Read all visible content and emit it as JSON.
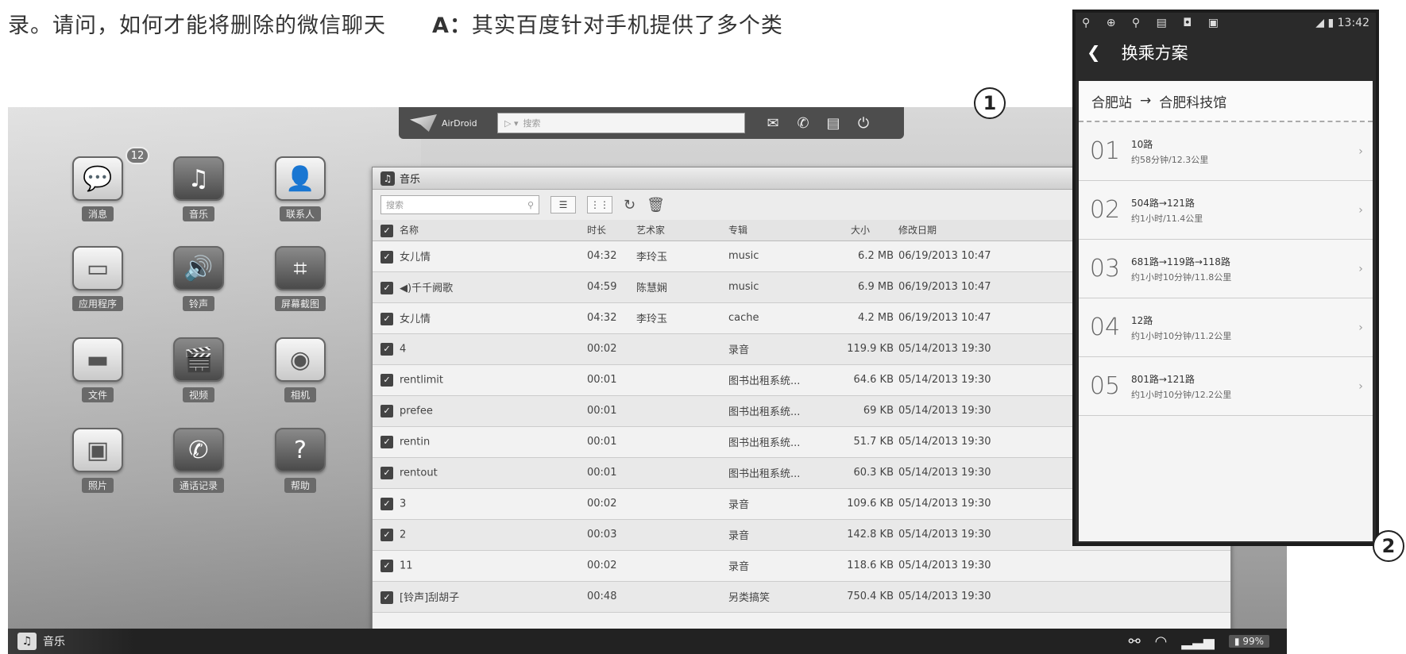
{
  "caption": {
    "left": "录。请问，如何才能将删除的微信聊天",
    "right_prefix": "A：",
    "right": "其实百度针对手机提供了多个类"
  },
  "markers": {
    "one": "1",
    "two": "2"
  },
  "airdroid": {
    "logo_text": "AirDroid",
    "search_placeholder": "搜索",
    "top_icons": [
      "mail-icon",
      "phone-icon",
      "sms-icon",
      "power-icon"
    ],
    "apps": [
      {
        "name": "messages-app",
        "label": "消息",
        "icon": "💬",
        "badge": "12",
        "light": true
      },
      {
        "name": "music-app",
        "label": "音乐",
        "icon": "♫",
        "light": false
      },
      {
        "name": "contacts-app",
        "label": "联系人",
        "icon": "👤",
        "light": true
      },
      {
        "name": "apps-app",
        "label": "应用程序",
        "icon": "▭",
        "light": true
      },
      {
        "name": "ringtones-app",
        "label": "铃声",
        "icon": "🔊",
        "light": false
      },
      {
        "name": "screenshot-app",
        "label": "屏幕截图",
        "icon": "⌗",
        "light": false
      },
      {
        "name": "files-app",
        "label": "文件",
        "icon": "▬",
        "light": true
      },
      {
        "name": "video-app",
        "label": "视频",
        "icon": "🎬",
        "light": false
      },
      {
        "name": "camera-app",
        "label": "相机",
        "icon": "◉",
        "light": true
      },
      {
        "name": "photos-app",
        "label": "照片",
        "icon": "▣",
        "light": true
      },
      {
        "name": "call-log-app",
        "label": "通话记录",
        "icon": "✆",
        "light": false
      },
      {
        "name": "help-app",
        "label": "帮助",
        "icon": "?",
        "light": false
      }
    ],
    "music_window": {
      "title": "音乐",
      "search_placeholder": "搜索",
      "columns": [
        "名称",
        "时长",
        "艺术家",
        "专辑",
        "大小",
        "修改日期"
      ],
      "rows": [
        [
          "女儿情",
          "04:32",
          "李玲玉",
          "music",
          "6.2 MB",
          "06/19/2013 10:47"
        ],
        [
          "◀)千千阙歌",
          "04:59",
          "陈慧娴",
          "music",
          "6.9 MB",
          "06/19/2013 10:47"
        ],
        [
          "女儿情",
          "04:32",
          "李玲玉",
          "cache",
          "4.2 MB",
          "06/19/2013 10:47"
        ],
        [
          "4",
          "00:02",
          "",
          "录音",
          "119.9 KB",
          "05/14/2013 19:30"
        ],
        [
          "rentlimit",
          "00:01",
          "",
          "图书出租系统...",
          "64.6 KB",
          "05/14/2013 19:30"
        ],
        [
          "prefee",
          "00:01",
          "",
          "图书出租系统...",
          "69 KB",
          "05/14/2013 19:30"
        ],
        [
          "rentin",
          "00:01",
          "",
          "图书出租系统...",
          "51.7 KB",
          "05/14/2013 19:30"
        ],
        [
          "rentout",
          "00:01",
          "",
          "图书出租系统...",
          "60.3 KB",
          "05/14/2013 19:30"
        ],
        [
          "3",
          "00:02",
          "",
          "录音",
          "109.6 KB",
          "05/14/2013 19:30"
        ],
        [
          "2",
          "00:03",
          "",
          "录音",
          "142.8 KB",
          "05/14/2013 19:30"
        ],
        [
          "11",
          "00:02",
          "",
          "录音",
          "118.6 KB",
          "05/14/2013 19:30"
        ],
        [
          "[铃声]刮胡子",
          "00:48",
          "",
          "另类搞笑",
          "750.4 KB",
          "05/14/2013 19:30"
        ]
      ]
    },
    "taskbar": {
      "item_label": "音乐",
      "battery": "99%"
    }
  },
  "phone": {
    "status_left": "⚲ ⊕ ⚲ ▤ ◘ ▣",
    "status_right": "13:42",
    "title": "换乘方案",
    "route_from": "合肥站",
    "route_arrow": "→",
    "route_to": "合肥科技馆",
    "plans": [
      {
        "num": "01",
        "lines": "10路",
        "detail": "约58分钟/12.3公里"
      },
      {
        "num": "02",
        "lines": "504路→121路",
        "detail": "约1小时/11.4公里"
      },
      {
        "num": "03",
        "lines": "681路→119路→118路",
        "detail": "约1小时10分钟/11.8公里"
      },
      {
        "num": "04",
        "lines": "12路",
        "detail": "约1小时10分钟/11.2公里"
      },
      {
        "num": "05",
        "lines": "801路→121路",
        "detail": "约1小时10分钟/12.2公里"
      }
    ]
  }
}
